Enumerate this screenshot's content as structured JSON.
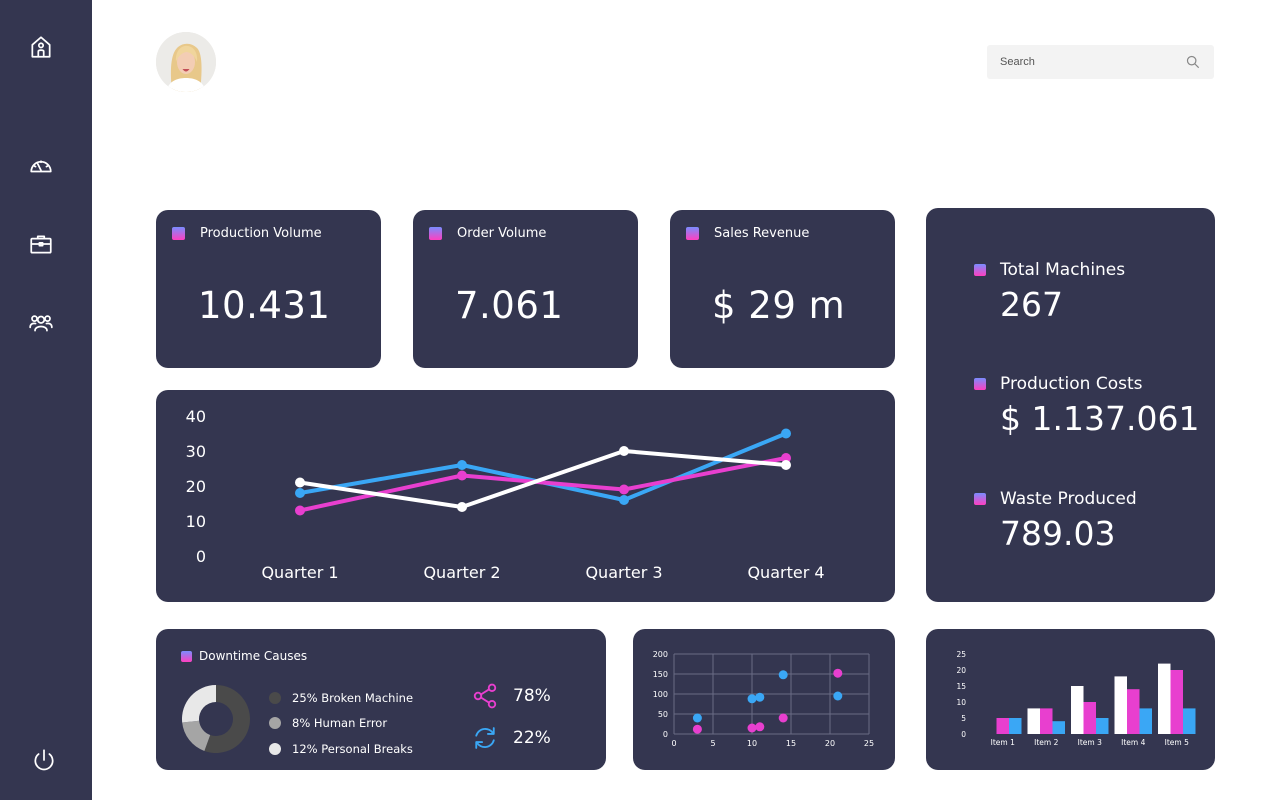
{
  "sidebar": {
    "icons": [
      "home-icon",
      "speedometer-icon",
      "briefcase-icon",
      "users-icon",
      "power-icon"
    ]
  },
  "search": {
    "placeholder": "Search"
  },
  "kpis": [
    {
      "title": "Production Volume",
      "value": "10.431"
    },
    {
      "title": "Order Volume",
      "value": "7.061"
    },
    {
      "title": "Sales Revenue",
      "value": "$ 29 m"
    }
  ],
  "stats": [
    {
      "label": "Total Machines",
      "value": "267"
    },
    {
      "label": "Production Costs",
      "value": "$ 1.137.061"
    },
    {
      "label": "Waste Produced",
      "value": "789.03"
    }
  ],
  "downtime": {
    "title": "Downtime Causes",
    "items": [
      {
        "label": "25% Broken Machine",
        "color": "#4a4a4a",
        "pct": 25
      },
      {
        "label": "8% Human Error",
        "color": "#a5a5a5",
        "pct": 8
      },
      {
        "label": "12% Personal Breaks",
        "color": "#e8e8e8",
        "pct": 12
      }
    ],
    "metrics": [
      {
        "icon": "share-icon",
        "value": "78%",
        "color": "#e83fcf"
      },
      {
        "icon": "refresh-icon",
        "value": "22%",
        "color": "#3aa7f5"
      }
    ]
  },
  "colors": {
    "pink": "#e83fcf",
    "blue": "#3aa7f5",
    "white": "#ffffff",
    "card": "#343650"
  },
  "chart_data": [
    {
      "type": "line",
      "categories": [
        "Quarter 1",
        "Quarter 2",
        "Quarter 3",
        "Quarter 4"
      ],
      "ylim": [
        0,
        40
      ],
      "yticks": [
        0,
        10,
        20,
        30,
        40
      ],
      "series": [
        {
          "color": "#3aa7f5",
          "values": [
            18,
            26,
            16,
            35
          ]
        },
        {
          "color": "#e83fcf",
          "values": [
            13,
            23,
            19,
            28
          ]
        },
        {
          "color": "#ffffff",
          "values": [
            21,
            14,
            30,
            26
          ]
        }
      ]
    },
    {
      "type": "scatter",
      "xlim": [
        0,
        25
      ],
      "ylim": [
        0,
        200
      ],
      "xticks": [
        0,
        5,
        10,
        15,
        20,
        25
      ],
      "yticks": [
        0,
        50,
        100,
        150,
        200
      ],
      "grid": true,
      "series": [
        {
          "color": "#3aa7f5",
          "points": [
            [
              3,
              40
            ],
            [
              10,
              88
            ],
            [
              11,
              92
            ],
            [
              14,
              148
            ],
            [
              21,
              95
            ]
          ]
        },
        {
          "color": "#e83fcf",
          "points": [
            [
              3,
              12
            ],
            [
              10,
              15
            ],
            [
              11,
              18
            ],
            [
              14,
              40
            ],
            [
              21,
              152
            ]
          ]
        }
      ]
    },
    {
      "type": "bar",
      "categories": [
        "Item 1",
        "Item 2",
        "Item 3",
        "Item 4",
        "Item 5"
      ],
      "ylim": [
        0,
        25
      ],
      "yticks": [
        0,
        5,
        10,
        15,
        20,
        25
      ],
      "series": [
        {
          "color": "#ffffff",
          "values": [
            0,
            8,
            15,
            18,
            22
          ]
        },
        {
          "color": "#e83fcf",
          "values": [
            5,
            8,
            10,
            14,
            20
          ]
        },
        {
          "color": "#3aa7f5",
          "values": [
            5,
            4,
            5,
            8,
            8
          ]
        }
      ]
    }
  ]
}
